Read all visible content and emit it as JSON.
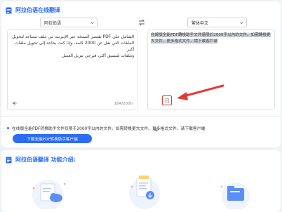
{
  "header": {
    "title": "阿拉伯语在线翻译"
  },
  "source_select": {
    "value": "阿拉伯语"
  },
  "target_select": {
    "value": "繁体中文"
  },
  "source": {
    "line1": "الشامل على PDF تقتصر النسخة عبر الإنترنت من ملف مساعد لتحويل",
    "line2": "الملفات التي تقل عن 2000 كلمة، وإذا كنت بحاجة إلى تحويل ملفات أكبر",
    "line3": "وملفات لتنسيق أكثر، فيرجى تنزيل العميل",
    "counter": "164/2000"
  },
  "target": {
    "text": "在線版全能PDF轉換助手文件僅限於2000字以內的文件。如需轉換更大文件、更多格式文件，請下載客戶端"
  },
  "notice": {
    "text": "在线版全能PDF转换助手文件仅限于2000字以内的文件。如需转换更大文件、更多格式文件，请下载客户端",
    "button_label": "下载全能PDF转换助手客户端"
  },
  "features": {
    "title": "阿拉伯语翻译 功能介绍:"
  },
  "colors": {
    "accent": "#2d6cf5",
    "highlight": "#e53935"
  },
  "icons": [
    "document-icon",
    "caret-down-icon",
    "swap-icon",
    "speaker-icon",
    "copy-icon",
    "bullet-dot-icon"
  ]
}
